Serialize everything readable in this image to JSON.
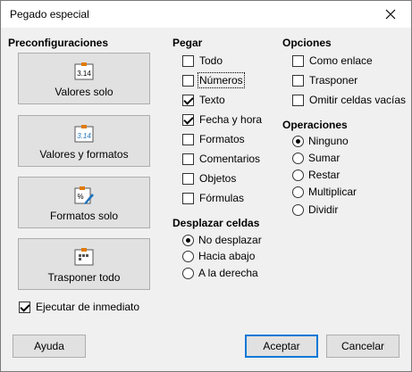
{
  "window": {
    "title": "Pegado especial",
    "close_icon": "close-icon"
  },
  "presets": {
    "heading": "Preconfiguraciones",
    "items": [
      {
        "label": "Valores solo",
        "icon": "paste-values-icon",
        "icon_text": "3.14"
      },
      {
        "label": "Valores y formatos",
        "icon": "paste-values-formats-icon",
        "icon_text": "3.14"
      },
      {
        "label": "Formatos solo",
        "icon": "paste-formats-icon"
      },
      {
        "label": "Trasponer todo",
        "icon": "paste-transpose-icon"
      }
    ],
    "run_immediately": {
      "label": "Ejecutar de inmediato",
      "checked": true
    }
  },
  "paste": {
    "heading": "Pegar",
    "items": [
      {
        "label": "Todo",
        "checked": false
      },
      {
        "label": "Números",
        "checked": false
      },
      {
        "label": "Texto",
        "checked": true
      },
      {
        "label": "Fecha y hora",
        "checked": true
      },
      {
        "label": "Formatos",
        "checked": false
      },
      {
        "label": "Comentarios",
        "checked": false
      },
      {
        "label": "Objetos",
        "checked": false
      },
      {
        "label": "Fórmulas",
        "checked": false
      }
    ]
  },
  "shift": {
    "heading": "Desplazar celdas",
    "items": [
      {
        "label": "No desplazar",
        "selected": true
      },
      {
        "label": "Hacia abajo",
        "selected": false
      },
      {
        "label": "A la derecha",
        "selected": false
      }
    ]
  },
  "options": {
    "heading": "Opciones",
    "items": [
      {
        "label": "Como enlace",
        "checked": false
      },
      {
        "label": "Trasponer",
        "checked": false
      },
      {
        "label": "Omitir celdas vacías",
        "checked": false
      }
    ]
  },
  "operations": {
    "heading": "Operaciones",
    "items": [
      {
        "label": "Ninguno",
        "selected": true
      },
      {
        "label": "Sumar",
        "selected": false
      },
      {
        "label": "Restar",
        "selected": false
      },
      {
        "label": "Multiplicar",
        "selected": false
      },
      {
        "label": "Dividir",
        "selected": false
      }
    ]
  },
  "buttons": {
    "help": "Ayuda",
    "ok": "Aceptar",
    "cancel": "Cancelar"
  },
  "colors": {
    "accent": "#0078d7",
    "icon_blue": "#1e73be",
    "icon_orange": "#e07b00"
  }
}
